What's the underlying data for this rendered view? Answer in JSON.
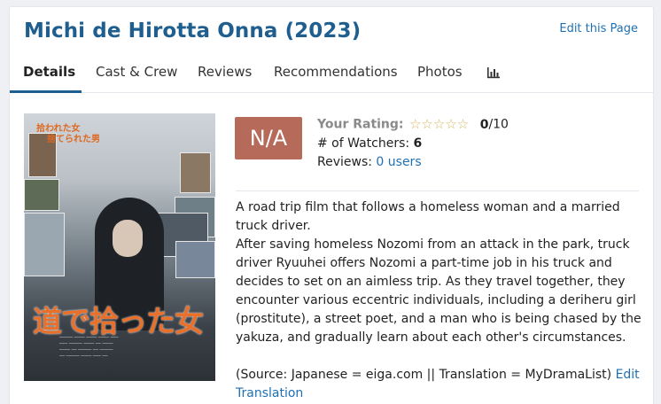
{
  "page": {
    "title": "Michi de Hirotta Onna (2023)",
    "edit_page": "Edit this Page"
  },
  "tabs": [
    {
      "label": "Details"
    },
    {
      "label": "Cast & Crew"
    },
    {
      "label": "Reviews"
    },
    {
      "label": "Recommendations"
    },
    {
      "label": "Photos"
    }
  ],
  "poster": {
    "top_text_line1": "拾われた女",
    "top_text_line2": "捨てられた男",
    "big_title": "道で拾った女"
  },
  "rating": {
    "box": "N/A",
    "your_rating_label": "Your Rating:",
    "stars": "☆☆☆☆☆",
    "score": "0",
    "score_suffix": "/10",
    "watchers_label": "# of Watchers:",
    "watchers_count": "6",
    "reviews_label": "Reviews:",
    "reviews_link": "0 users"
  },
  "description": {
    "line1": "A road trip film that follows a homeless woman and a married truck driver.",
    "line2": "After saving homeless Nozomi from an attack in the park, truck driver Ryuuhei offers Nozomi a part-time job in his truck and decides to set on an aimless trip. As they travel together, they encounter various eccentric individuals, including a deriheru girl (prostitute), a street poet, and a man who is being chased by the yakuza, and gradually learn about each other's circumstances.",
    "source": "(Source: Japanese = eiga.com || Translation = MyDramaList)",
    "edit_translation": "Edit Translation"
  }
}
